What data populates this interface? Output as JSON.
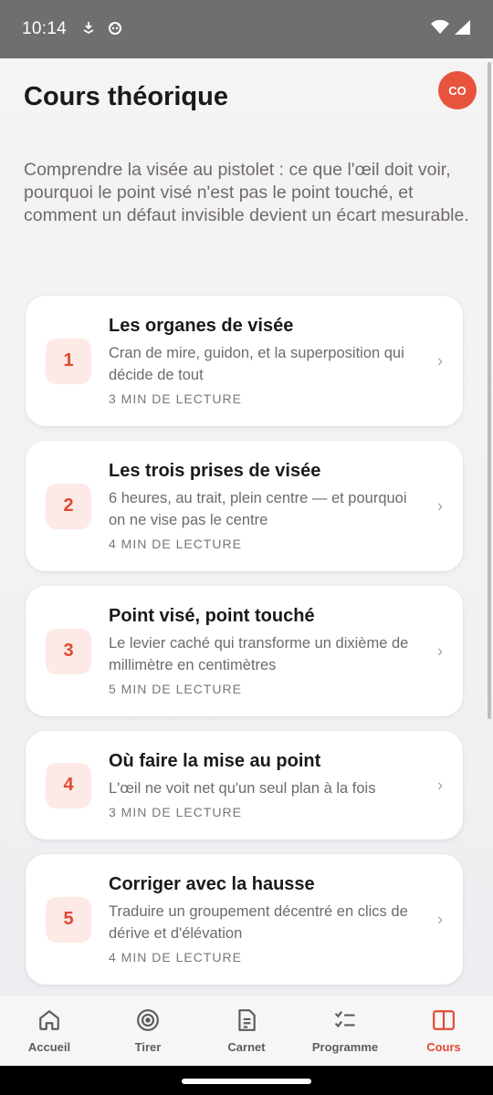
{
  "status_bar": {
    "time": "10:14"
  },
  "header": {
    "title": "Cours théorique",
    "avatar_initials": "CO"
  },
  "intro": "Comprendre la visée au pistolet : ce que l'œil doit voir, pourquoi le point visé n'est pas le point touché, et comment un défaut invisible devient un écart mesurable.",
  "lessons": [
    {
      "number": "1",
      "title": "Les organes de visée",
      "description": "Cran de mire, guidon, et la superposition qui décide de tout",
      "meta": "3 MIN DE LECTURE"
    },
    {
      "number": "2",
      "title": "Les trois prises de visée",
      "description": "6 heures, au trait, plein centre — et pourquoi on ne vise pas le centre",
      "meta": "4 MIN DE LECTURE"
    },
    {
      "number": "3",
      "title": "Point visé, point touché",
      "description": "Le levier caché qui transforme un dixième de millimètre en centimètres",
      "meta": "5 MIN DE LECTURE"
    },
    {
      "number": "4",
      "title": "Où faire la mise au point",
      "description": "L'œil ne voit net qu'un seul plan à la fois",
      "meta": "3 MIN DE LECTURE"
    },
    {
      "number": "5",
      "title": "Corriger avec la hausse",
      "description": "Traduire un groupement décentré en clics de dérive et d'élévation",
      "meta": "4 MIN DE LECTURE"
    }
  ],
  "bottom_nav": [
    {
      "label": "Accueil",
      "icon": "home-icon"
    },
    {
      "label": "Tirer",
      "icon": "target-icon"
    },
    {
      "label": "Carnet",
      "icon": "notebook-icon"
    },
    {
      "label": "Programme",
      "icon": "checklist-icon"
    },
    {
      "label": "Cours",
      "icon": "book-icon",
      "active": true
    }
  ],
  "colors": {
    "accent": "#e04a33",
    "badge_bg": "#fde9e5",
    "status_bar": "#6f6f6f"
  }
}
